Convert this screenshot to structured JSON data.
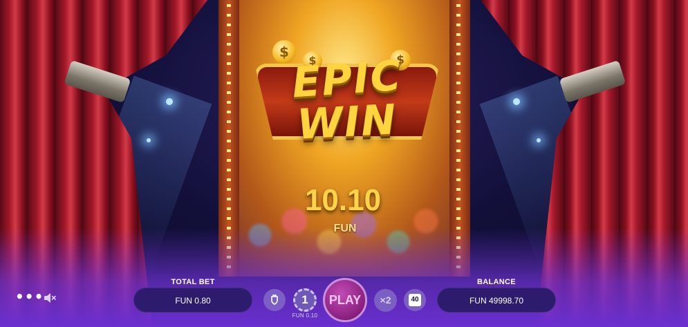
{
  "game": {
    "banner_line1": "EPIC",
    "banner_line2": "WIN",
    "coin_symbol": "$",
    "win_amount": "10.10",
    "win_currency": "FUN"
  },
  "controls": {
    "total_bet_label": "TOTAL BET",
    "total_bet_value": "FUN 0.80",
    "coin_value": "1",
    "coin_sub_label": "FUN 0.10",
    "play_label": "PLAY",
    "multiplier_label": "×2",
    "autoplay_count": "40",
    "balance_label": "BALANCE",
    "balance_value": "FUN 49998.70",
    "menu_glyph": "•••"
  },
  "icons": {
    "menu": "more-dots-icon",
    "sound": "speaker-muted-icon",
    "bet_reset": "shield-icon"
  },
  "colors": {
    "accent_gold": "#ffd34a",
    "play_button": "#9a2a8e",
    "pill_bg": "#2d1c6e",
    "round_button_bg": "#7b5fc4"
  }
}
